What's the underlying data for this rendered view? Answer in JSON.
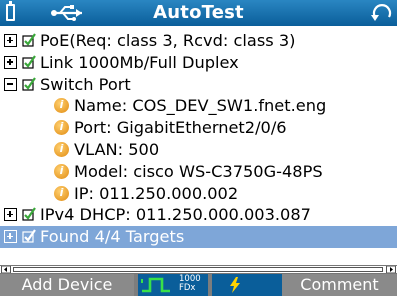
{
  "app": {
    "title": "AutoTest"
  },
  "titlebar_icons": [
    "battery-icon",
    "usb-icon",
    "refresh-icon"
  ],
  "tree": {
    "rows": [
      {
        "expander": "plus",
        "check": true,
        "text": "PoE(Req: class 3, Rcvd: class 3)"
      },
      {
        "expander": "plus",
        "check": true,
        "text": "Link 1000Mb/Full Duplex"
      },
      {
        "expander": "minus",
        "check": true,
        "text": "Switch Port"
      },
      {
        "info": true,
        "text": "Name: COS_DEV_SW1.fnet.eng"
      },
      {
        "info": true,
        "text": "Port: GigabitEthernet2/0/6"
      },
      {
        "info": true,
        "text": "VLAN: 500"
      },
      {
        "info": true,
        "text": "Model: cisco WS-C3750G-48PS"
      },
      {
        "info": true,
        "text": "IP: 011.250.000.002"
      },
      {
        "expander": "plus",
        "check": true,
        "text": "IPv4 DHCP: 011.250.000.003.087"
      },
      {
        "expander": "plus",
        "check": true,
        "text": "Found 4/4 Targets",
        "selected": true
      }
    ]
  },
  "toolbar": {
    "add_device": "Add Device",
    "link_speed": "1000",
    "link_duplex": "FDx",
    "comment": "Comment"
  },
  "colors": {
    "titlebar": "#0a5e9a",
    "selection": "#7ea6d8",
    "toolbar": "#7d7d7d",
    "check_green": "#3aa83a",
    "link_green": "#39e04a",
    "bolt_yellow": "#ffd400"
  }
}
